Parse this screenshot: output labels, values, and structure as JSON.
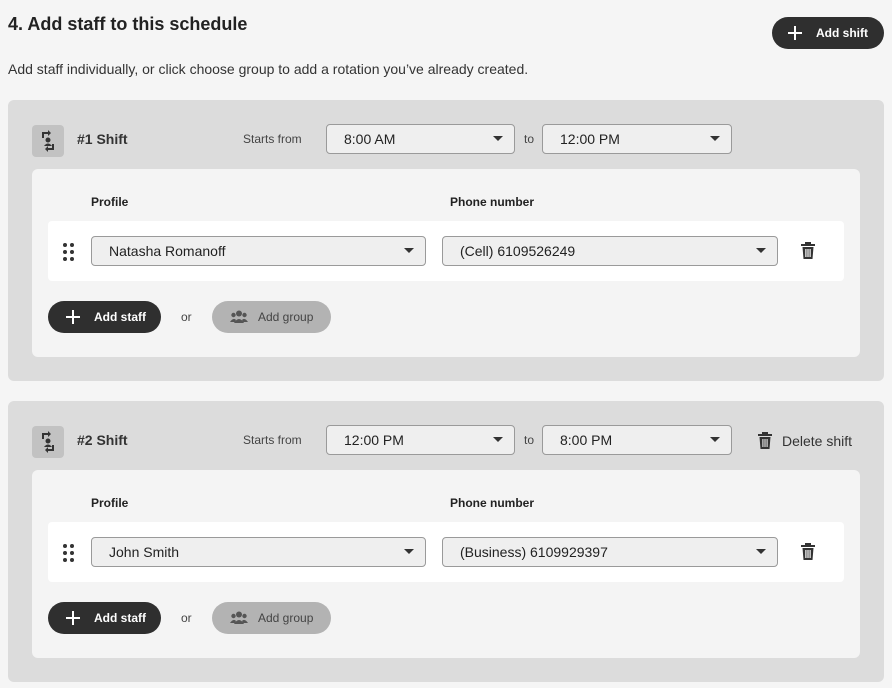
{
  "header": {
    "title": "4. Add staff to this schedule",
    "subtitle": "Add staff individually, or click choose group to add a rotation you’ve already created.",
    "add_shift_label": "Add shift"
  },
  "shifts": [
    {
      "title": "#1 Shift",
      "starts_from_label": "Starts from",
      "start_time": "8:00 AM",
      "to_label": "to",
      "end_time": "12:00 PM",
      "delete_label": "",
      "profile_label": "Profile",
      "phone_label": "Phone number",
      "staff": {
        "profile": "Natasha Romanoff",
        "phone": "(Cell) 6109526249"
      },
      "add_staff_label": "Add staff",
      "or_label": "or",
      "add_group_label": "Add group"
    },
    {
      "title": "#2 Shift",
      "starts_from_label": "Starts from",
      "start_time": "12:00 PM",
      "to_label": "to",
      "end_time": "8:00 PM",
      "delete_label": "Delete shift",
      "profile_label": "Profile",
      "phone_label": "Phone number",
      "staff": {
        "profile": "John Smith",
        "phone": "(Business) 6109929397"
      },
      "add_staff_label": "Add staff",
      "or_label": "or",
      "add_group_label": "Add group"
    }
  ],
  "icons": {
    "shift": "rotation-person-icon",
    "drag": "drag-handle-icon",
    "trash": "trash-icon",
    "plus": "plus-icon",
    "group": "group-icon",
    "caret": "chevron-down-icon"
  },
  "colors": {
    "dark_button": "#2f2f2f",
    "disabled_button": "#b3b3b3",
    "card_background": "#dcdcdc",
    "page_background": "#f5f5f5"
  }
}
